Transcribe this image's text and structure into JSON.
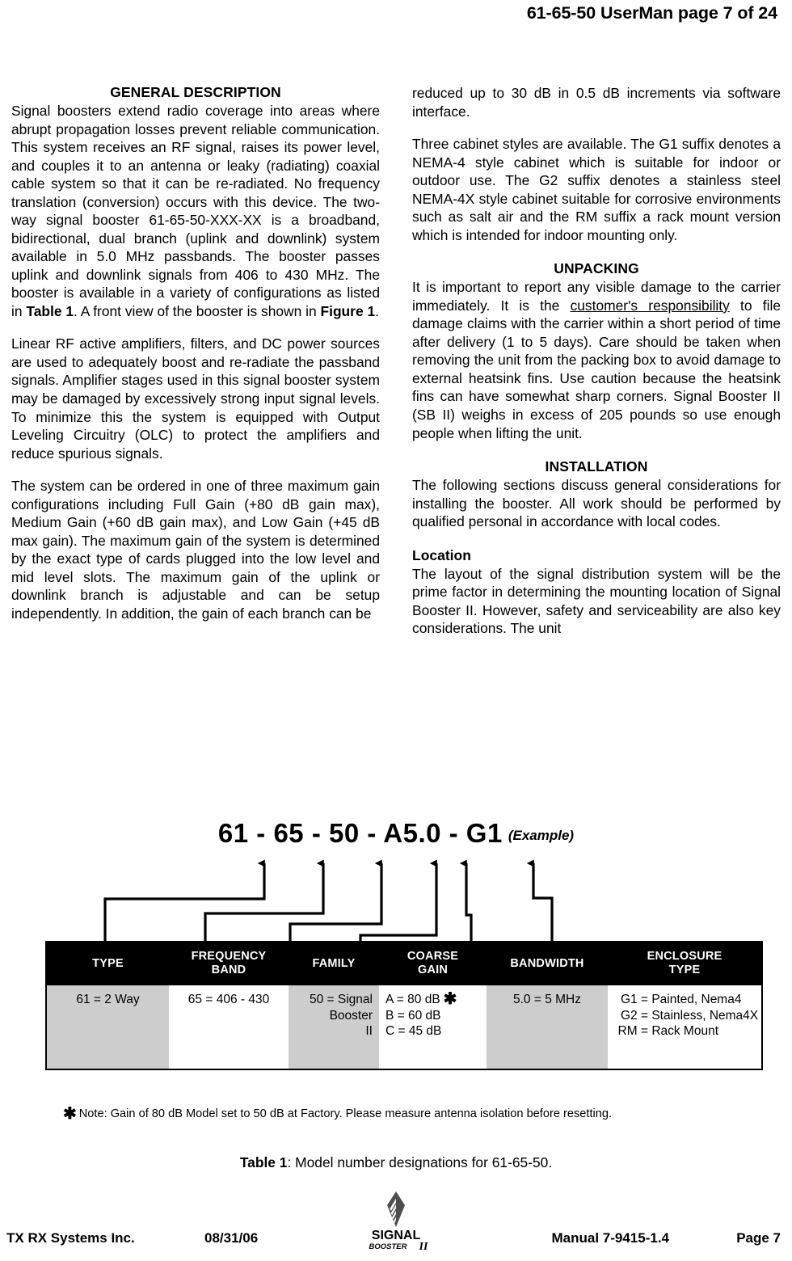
{
  "header": {
    "running_head": "61-65-50 UserMan page 7 of 24"
  },
  "left_column": {
    "section_title": "GENERAL DESCRIPTION",
    "para1_a": "Signal boosters extend radio coverage into areas where abrupt propagation losses prevent reliable communication. This system receives an RF signal, raises its power level, and couples it to an antenna or leaky (radiating) coaxial cable system so that it can be re-radiated. No frequency translation (conversion) occurs with this device. The two-way signal booster 61-65-50-XXX-XX is a broadband, bidirectional, dual branch (uplink and downlink) system available in 5.0 MHz passbands. The booster passes uplink and downlink signals from 406 to 430 MHz. The booster is available in a variety of configurations as listed in ",
    "para1_ref1": "Table 1",
    "para1_b": ". A front view of the booster is shown in ",
    "para1_ref2": "Figure 1",
    "para1_c": ".",
    "para2": "Linear RF active amplifiers, filters, and DC power sources are used to adequately boost and re-radiate the passband signals. Amplifier stages used in this signal booster system may be damaged by excessively strong input signal levels. To minimize this the system is equipped with Output Leveling Circuitry (OLC) to protect the amplifiers and reduce spurious signals.",
    "para3": "The system can be ordered in one of three maximum gain configurations including Full Gain (+80 dB gain max), Medium Gain (+60 dB gain max), and Low Gain (+45 dB max gain). The maximum gain of the system is determined by the exact type of cards plugged into the low level and mid level slots. The maximum gain of the uplink or downlink branch is adjustable and can be setup independently. In addition, the gain of each branch can be"
  },
  "right_column": {
    "para1": "reduced up to 30 dB in 0.5 dB increments via software interface.",
    "para2": "Three cabinet styles are available. The G1 suffix denotes a NEMA-4 style cabinet which is suitable for indoor or outdoor use. The G2 suffix denotes a stainless steel NEMA-4X style cabinet suitable for corrosive environments such as salt air and the RM suffix a rack mount version which is intended for indoor mounting only.",
    "unpacking_title": "UNPACKING",
    "unpacking_a": "It is important to report any visible damage to the carrier immediately. It is the ",
    "unpacking_underlined": "customer's responsibility",
    "unpacking_b": " to file damage claims with the carrier within a short period of time after delivery (1 to 5 days). Care should be taken when removing the unit from the packing box to avoid damage to external heatsink fins. Use caution because the heatsink fins can have somewhat sharp corners. Signal Booster II (SB II) weighs in excess of 205 pounds so use enough people when lifting the unit.",
    "installation_title": "INSTALLATION",
    "installation_para": "The following sections discuss general considerations for installing the booster. All work should be performed by qualified personal in accordance with local codes.",
    "location_title": "Location",
    "location_para": "The layout of the signal distribution system will be the prime factor in determining the mounting location of Signal Booster II. However, safety and serviceability are also key considerations. The unit"
  },
  "figure": {
    "model_number": "61 - 65 - 50 - A5.0 - G1",
    "example_label": "(Example)",
    "table": {
      "headers": [
        {
          "line1": "TYPE",
          "line2": ""
        },
        {
          "line1": "FREQUENCY",
          "line2": "BAND"
        },
        {
          "line1": "FAMILY",
          "line2": ""
        },
        {
          "line1": "COARSE",
          "line2": "GAIN"
        },
        {
          "line1": "BANDWIDTH",
          "line2": ""
        },
        {
          "line1": "ENCLOSURE",
          "line2": "TYPE"
        }
      ],
      "cells": {
        "type": "61 = 2 Way",
        "frequency_band": "65  = 406 - 430",
        "family_l1": "50 =  Signal",
        "family_l2": "Booster",
        "family_l3": "II",
        "gain_l1": "A =  80 dB",
        "gain_l2": "B =  60 dB",
        "gain_l3": "C =  45 dB",
        "bandwidth": "5.0  =  5 MHz",
        "enc1_code": "G1 =",
        "enc1_text": "Painted, Nema4",
        "enc2_code": "G2 =",
        "enc2_text": "Stainless, Nema4X",
        "enc3_code": "RM =",
        "enc3_text": "Rack Mount"
      }
    },
    "note": "Note: Gain of 80 dB Model set to 50 dB at Factory. Please measure antenna isolation before resetting.",
    "caption_bold": "Table 1",
    "caption_rest": ": Model number designations for 61-65-50."
  },
  "footer": {
    "company": "TX RX Systems Inc.",
    "date": "08/31/06",
    "manual": "Manual 7-9415-1.4",
    "page": "Page 7",
    "logo_primary": "SIGNAL",
    "logo_secondary": "BOOSTER",
    "logo_numeral": "II"
  }
}
